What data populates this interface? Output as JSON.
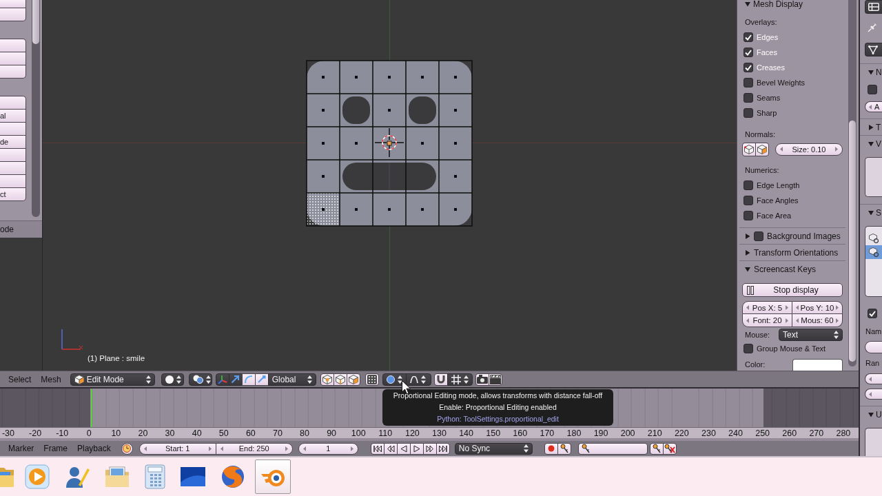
{
  "tool_shelf": {
    "button_groups": [
      [
        {
          "kind": "button"
        },
        {
          "kind": "button"
        }
      ],
      [
        {
          "kind": "button"
        },
        {
          "kind": "button"
        },
        {
          "kind": "button"
        }
      ],
      [
        {
          "kind": "button"
        },
        {
          "kind": "button",
          "label": "al"
        },
        {
          "kind": "button"
        },
        {
          "kind": "button",
          "label": "de"
        },
        {
          "kind": "button"
        },
        {
          "kind": "button"
        },
        {
          "kind": "button"
        },
        {
          "kind": "button",
          "label": "ct"
        }
      ]
    ],
    "operator_title": "ode"
  },
  "viewport": {
    "object_info": "(1) Plane : smile"
  },
  "sidebar": {
    "mesh_display": {
      "title": "Mesh Display",
      "expanded": true,
      "overlays_label": "Overlays:",
      "overlays": [
        {
          "label": "Edges",
          "checked": true
        },
        {
          "label": "Faces",
          "checked": true
        },
        {
          "label": "Creases",
          "checked": true
        },
        {
          "label": "Bevel Weights",
          "checked": false
        },
        {
          "label": "Seams",
          "checked": false
        },
        {
          "label": "Sharp",
          "checked": false
        }
      ],
      "normals_label": "Normals:",
      "normal_size": "Size: 0.10",
      "numerics_label": "Numerics:",
      "numerics": [
        {
          "label": "Edge Length",
          "checked": false
        },
        {
          "label": "Face Angles",
          "checked": false
        },
        {
          "label": "Face Area",
          "checked": false
        }
      ]
    },
    "collapsed_panels": [
      {
        "title": "Background Images",
        "expanded": false,
        "checked": false
      },
      {
        "title": "Transform Orientations",
        "expanded": false
      }
    ],
    "screencast_keys": {
      "title": "Screencast Keys",
      "expanded": true,
      "stop_button": "Stop display",
      "fields": [
        "Pos X: 5",
        "Pos Y: 10",
        "Font: 20",
        "Mous: 60"
      ],
      "mouse_label": "Mouse:",
      "mouse_mode": "Text",
      "group_option": {
        "label": "Group Mouse & Text",
        "checked": false
      },
      "color_label": "Color:"
    }
  },
  "properties_editor": {
    "rows": [
      {
        "kind": "editor_menu"
      },
      {
        "kind": "pin"
      },
      {
        "kind": "data_tab"
      },
      {
        "kind": "panel_header",
        "title": "N",
        "expanded": true
      },
      {
        "kind": "checkbox",
        "checked": false
      },
      {
        "kind": "number_field",
        "text": "A"
      },
      {
        "kind": "panel_header",
        "title": "T",
        "expanded": false
      },
      {
        "kind": "panel_header",
        "title": "V",
        "expanded": true
      },
      {
        "kind": "list_box"
      },
      {
        "kind": "panel_header",
        "title": "S",
        "expanded": true
      },
      {
        "kind": "list_box",
        "items": [
          {
            "selected": false
          },
          {
            "selected": true
          }
        ]
      },
      {
        "kind": "checkbox",
        "checked": true
      },
      {
        "kind": "label",
        "text": "Nam"
      },
      {
        "kind": "text_field"
      },
      {
        "kind": "label",
        "text": "Ran"
      },
      {
        "kind": "number_field"
      },
      {
        "kind": "number_field"
      },
      {
        "kind": "panel_header",
        "title": "U",
        "expanded": true
      },
      {
        "kind": "box"
      }
    ]
  },
  "view_header": {
    "menus": [
      "Select",
      "Mesh"
    ],
    "mode": "Edit Mode",
    "manipulators": [
      {
        "on": true
      },
      {
        "on": true
      },
      {
        "on": false
      },
      {
        "on": false
      }
    ],
    "orientation": "Global"
  },
  "tooltip": {
    "description": "Proportional Editing mode, allows transforms with distance fall-off",
    "enable": "Enable: Proportional Editing enabled",
    "python": "Python: ToolSettings.proportional_edit"
  },
  "timeline": {
    "ruler_labels": [
      "-30",
      "-20",
      "-10",
      "0",
      "10",
      "20",
      "30",
      "40",
      "50",
      "60",
      "70",
      "80",
      "90",
      "100",
      "110",
      "120",
      "130",
      "140",
      "150",
      "160",
      "170",
      "180",
      "190",
      "200",
      "210",
      "220",
      "230",
      "240",
      "250",
      "260",
      "270",
      "280"
    ]
  },
  "timeline_header": {
    "menus": [
      "Marker",
      "Frame",
      "Playback"
    ],
    "start": "Start: 1",
    "end": "End: 250",
    "current_frame": "1",
    "sync": "No Sync"
  },
  "taskbar": {
    "apps": [
      {
        "kind": "folder",
        "selected": false
      },
      {
        "kind": "player",
        "selected": false
      },
      {
        "kind": "person",
        "selected": false
      },
      {
        "kind": "pictures",
        "selected": false
      },
      {
        "kind": "calculator",
        "selected": false
      },
      {
        "kind": "screen",
        "selected": false
      },
      {
        "kind": "browser",
        "selected": false
      },
      {
        "kind": "modeler",
        "selected": true
      }
    ]
  }
}
